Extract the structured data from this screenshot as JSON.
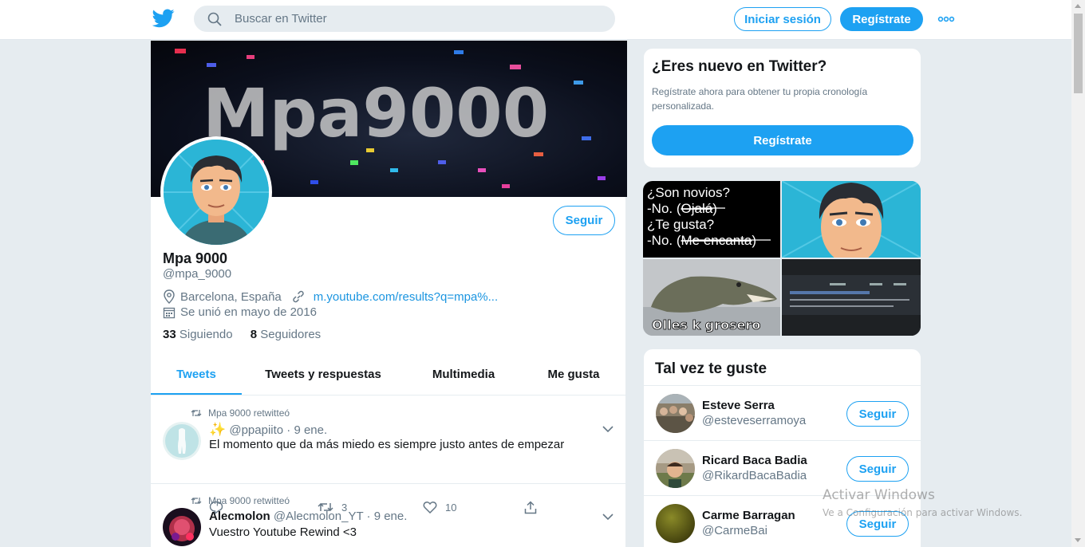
{
  "header": {
    "logo": "twitter-bird-icon",
    "search_placeholder": "Buscar en Twitter",
    "login_label": "Iniciar sesión",
    "signup_label": "Regístrate",
    "more_icon": "more-dots-icon",
    "brand_color": "#1da1f2"
  },
  "profile": {
    "banner_text": "Mpa9000",
    "name": "Mpa 9000",
    "handle": "@mpa_9000",
    "follow_label": "Seguir",
    "location": "Barcelona, España",
    "link": "m.youtube.com/results?q=mpa%...",
    "joined": "Se unió en mayo de 2016",
    "following_count": "33",
    "following_label": "Siguiendo",
    "followers_count": "8",
    "followers_label": "Seguidores"
  },
  "tabs": [
    {
      "label": "Tweets",
      "active": true
    },
    {
      "label": "Tweets y respuestas",
      "active": false
    },
    {
      "label": "Multimedia",
      "active": false
    },
    {
      "label": "Me gusta",
      "active": false
    }
  ],
  "tweets": [
    {
      "retweet_label": "Mpa 9000 retwitteó",
      "sparkle": "✨",
      "name": "",
      "handle": "@ppapiito",
      "date": "· 9 ene.",
      "text": "El momento que da más miedo es siempre justo antes de empezar",
      "retweets": "3",
      "likes": "10"
    },
    {
      "retweet_label": "Mpa 9000 retwitteó",
      "name": "Alecmolon",
      "handle": "@Alecmolon_YT",
      "date": "· 9 ene.",
      "text": "Vuestro Youtube Rewind <3"
    }
  ],
  "new_to_twitter": {
    "title": "¿Eres nuevo en Twitter?",
    "subtitle": "Regístrate ahora para obtener tu propia cronología personalizada.",
    "button": "Regístrate"
  },
  "media": {
    "meme_lines": [
      "¿Son novios?",
      "-No. (",
      "Ojalá",
      ")",
      "¿Te gusta?",
      "-No. (",
      "Me encanta",
      ")"
    ],
    "croc_caption": "Olles k grosero"
  },
  "who_to_follow": {
    "title": "Tal vez te guste",
    "follow_label": "Seguir",
    "users": [
      {
        "name": "Esteve Serra",
        "handle": "@esteveserramoya"
      },
      {
        "name": "Ricard Baca Badia",
        "handle": "@RikardBacaBadia"
      },
      {
        "name": "Carme Barragan",
        "handle": "@CarmeBai"
      }
    ]
  },
  "watermark": {
    "title": "Activar Windows",
    "subtitle": "Ve a Configuración para activar Windows."
  }
}
